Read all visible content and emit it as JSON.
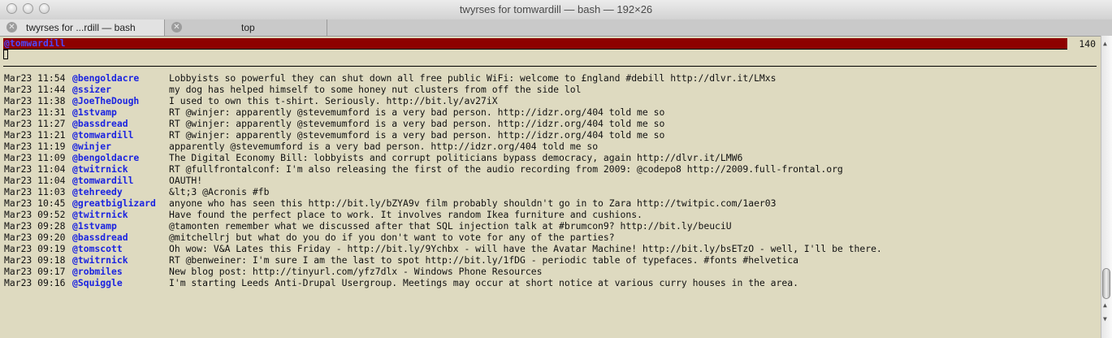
{
  "window": {
    "title": "twyrses for tomwardill — bash — 192×26"
  },
  "tabs": [
    {
      "label": "twyrses for ...rdill — bash",
      "active": true
    },
    {
      "label": "top",
      "active": false
    }
  ],
  "status": {
    "user": "@tomwardill",
    "char_count": "140"
  },
  "timeline": [
    {
      "time": "Mar23 11:54",
      "user": "@bengoldacre",
      "text": "Lobbyists so powerful they can shut down all free public WiFi: welcome to £ngland #debill http://dlvr.it/LMxs"
    },
    {
      "time": "Mar23 11:44",
      "user": "@ssizer",
      "text": "my dog has helped himself to some honey nut clusters from off the side lol"
    },
    {
      "time": "Mar23 11:38",
      "user": "@JoeTheDough",
      "text": "I used to own this t-shirt. Seriously. http://bit.ly/av27iX"
    },
    {
      "time": "Mar23 11:31",
      "user": "@1stvamp",
      "text": "RT @winjer: apparently @stevemumford is a very bad person.  http://idzr.org/404 told me so"
    },
    {
      "time": "Mar23 11:27",
      "user": "@bassdread",
      "text": "RT @winjer: apparently @stevemumford is a very bad person.  http://idzr.org/404 told me so"
    },
    {
      "time": "Mar23 11:21",
      "user": "@tomwardill",
      "text": "RT @winjer: apparently @stevemumford is a very bad person.  http://idzr.org/404 told me so"
    },
    {
      "time": "Mar23 11:19",
      "user": "@winjer",
      "text": "apparently @stevemumford is a very bad person.  http://idzr.org/404 told me so"
    },
    {
      "time": "Mar23 11:09",
      "user": "@bengoldacre",
      "text": "The Digital Economy Bill: lobbyists and corrupt politicians bypass democracy, again http://dlvr.it/LMW6"
    },
    {
      "time": "Mar23 11:04",
      "user": "@twitrnick",
      "text": "RT @fullfrontalconf: I'm also releasing the first of the audio recording from 2009: @codepo8 http://2009.full-frontal.org"
    },
    {
      "time": "Mar23 11:04",
      "user": "@tomwardill",
      "text": "OAUTH!"
    },
    {
      "time": "Mar23 11:03",
      "user": "@tehreedy",
      "text": "&lt;3 @Acronis #fb"
    },
    {
      "time": "Mar23 10:45",
      "user": "@greatbiglizard",
      "text": "anyone who has seen this http://bit.ly/bZYA9v film probably shouldn't go in to Zara http://twitpic.com/1aer03"
    },
    {
      "time": "Mar23 09:52",
      "user": "@twitrnick",
      "text": "Have found the perfect place to work. It involves random Ikea furniture and cushions."
    },
    {
      "time": "Mar23 09:28",
      "user": "@1stvamp",
      "text": "@tamonten remember what we discussed after that SQL injection talk at #brumcon9? http://bit.ly/beuciU"
    },
    {
      "time": "Mar23 09:20",
      "user": "@bassdread",
      "text": "@mitchellrj but what do you do if you don't want to vote for any of the parties?"
    },
    {
      "time": "Mar23 09:19",
      "user": "@tomscott",
      "text": "Oh wow: V&A Lates this Friday - http://bit.ly/9Ychbx - will have the Avatar Machine! http://bit.ly/bsETzO - well, I'll be there."
    },
    {
      "time": "Mar23 09:18",
      "user": "@twitrnick",
      "text": "RT @benweiner: I'm sure I am the last to spot http://bit.ly/1fDG - periodic table of typefaces. #fonts #helvetica"
    },
    {
      "time": "Mar23 09:17",
      "user": "@robmiles",
      "text": "New blog post: http://tinyurl.com/yfz7dlx - Windows Phone Resources"
    },
    {
      "time": "Mar23 09:16",
      "user": "@Squiggle",
      "text": "I'm starting Leeds Anti-Drupal Usergroup. Meetings may occur at short notice at various curry houses in the area."
    }
  ]
}
